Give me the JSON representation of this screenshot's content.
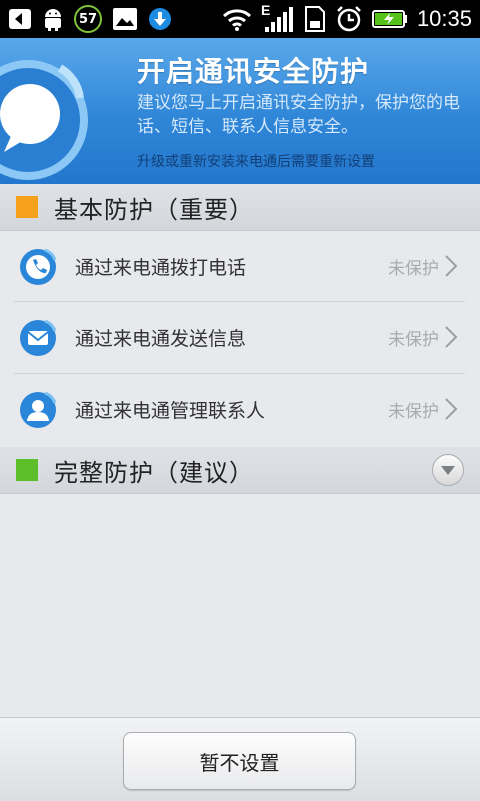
{
  "status_bar": {
    "icons": [
      "back-icon",
      "android-debug-icon",
      "badge-icon",
      "image-icon",
      "download-icon",
      "wifi-icon",
      "signal-edge-icon",
      "sd-card-icon",
      "alarm-icon",
      "battery-charging-icon"
    ],
    "badge_number": "57",
    "network_type": "E",
    "time": "10:35"
  },
  "header": {
    "title": "开启通讯安全防护",
    "description": "建议您马上开启通讯安全防护，保护您的电话、短信、联系人信息安全。",
    "note": "升级或重新安装来电通后需要重新设置",
    "logo_icon": "chat-bubble-logo-icon"
  },
  "sections": {
    "basic": {
      "title": "基本防护（重要）",
      "color": "#f5a11c"
    },
    "complete": {
      "title": "完整防护（建议）",
      "color": "#5cbf2a"
    }
  },
  "items": [
    {
      "label": "通过来电通拨打电话",
      "status": "未保护",
      "icon": "phone-icon"
    },
    {
      "label": "通过来电通发送信息",
      "status": "未保护",
      "icon": "message-icon"
    },
    {
      "label": "通过来电通管理联系人",
      "status": "未保护",
      "icon": "contact-icon"
    }
  ],
  "footer": {
    "skip_button": "暂不设置"
  },
  "colors": {
    "accent_blue": "#2f86d7",
    "icon_blue": "#2a86d8"
  }
}
